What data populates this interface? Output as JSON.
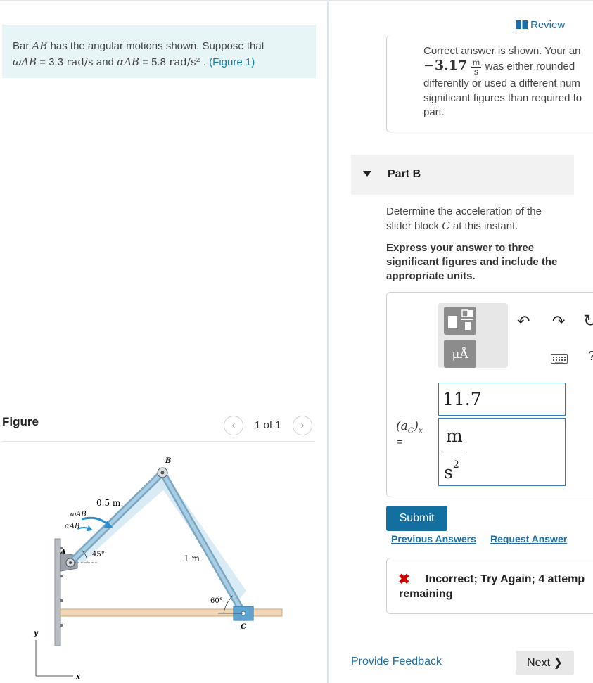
{
  "problem": {
    "text_prefix": "Bar",
    "bar_name": "AB",
    "text_mid1": "has the angular motions shown. Suppose that",
    "omega_symbol": "ωAB",
    "omega_eq": "= 3.3",
    "omega_unit": "rad/s",
    "and": "and",
    "alpha_symbol": "αAB",
    "alpha_eq": "= 5.8",
    "alpha_unit": "rad/s²",
    "figure_link": "(Figure 1)"
  },
  "figure_panel": {
    "heading": "Figure",
    "pager_count": "1 of 1",
    "prev_icon": "‹",
    "next_icon": "›",
    "labels": {
      "B": "B",
      "A": "A",
      "C": "C",
      "omega_ab": "ωAB",
      "alpha_ab": "αAB",
      "len_ab": "0.5 m",
      "len_bc": "1 m",
      "angle_a": "45°",
      "angle_c": "60°",
      "axis_x": "x",
      "axis_y": "y"
    }
  },
  "header": {
    "review_label": "Review"
  },
  "previous_feedback": {
    "line1": "Correct answer is shown. Your an",
    "value": "−3.17",
    "unit_num": "m",
    "unit_den": "s",
    "line2_rest": "was either rounded",
    "line3": "differently or used a different num",
    "line4": "significant figures than required fo",
    "line5": "part."
  },
  "part": {
    "label": "Part B",
    "question_prefix": "Determine the acceleration of the",
    "question_suffix_pre": "slider block",
    "question_var": "C",
    "question_suffix": "at this instant.",
    "instruction": "Express your answer to three significant figures and include the appropriate units."
  },
  "answer": {
    "label_main": "(a",
    "label_sub": "C",
    "label_close": ")",
    "label_x": "x",
    "equals": "=",
    "value": "11.7",
    "unit_num": "m",
    "unit_den": "s",
    "unit_exp": "2",
    "toolbar": {
      "unit_button_label": "μÅ",
      "undo": "↶",
      "redo": "↷",
      "reset": "↻",
      "help": "?"
    }
  },
  "actions": {
    "submit_label": "Submit",
    "previous_answers": "Previous Answers",
    "request_answer": "Request Answer"
  },
  "status": {
    "icon": "✖",
    "line1": "Incorrect; Try Again; 4 attemp",
    "line2": "remaining"
  },
  "footer": {
    "provide_feedback": "Provide Feedback",
    "next_label": "Next",
    "next_icon": "❯"
  },
  "colors": {
    "accent": "#136fa0",
    "link": "#1a6ea8",
    "error": "#d10000",
    "problem_bg": "#e8f5f7"
  }
}
